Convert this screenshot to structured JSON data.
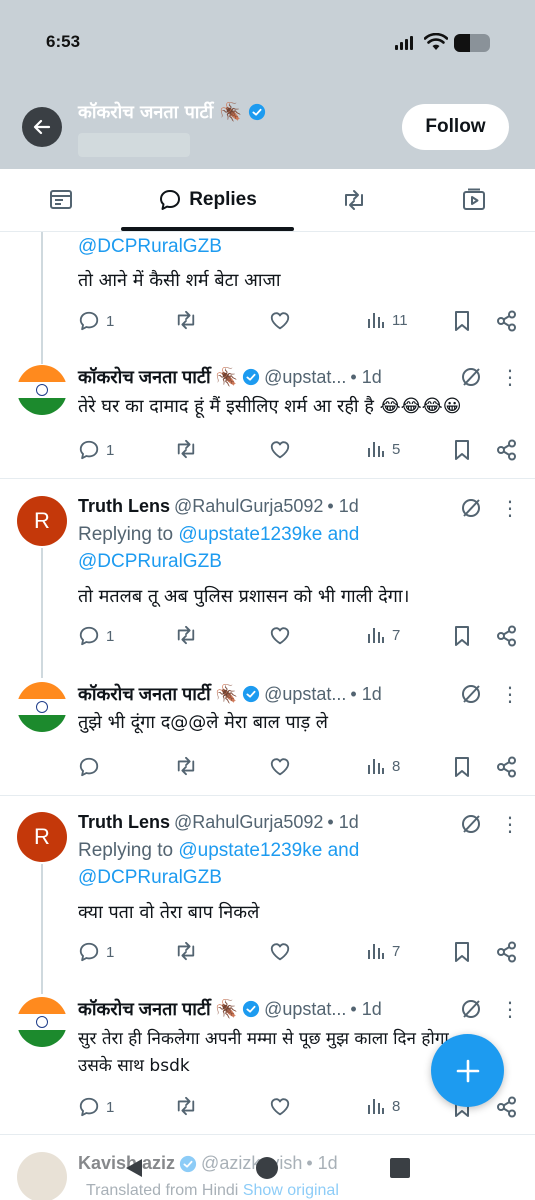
{
  "status_bar": {
    "time": "6:53",
    "battery_level": 0.45
  },
  "header": {
    "title": "कॉकरोच जनता पार्टी 🪳",
    "follow_label": "Follow"
  },
  "tabs": [
    {
      "name": "posts",
      "icon": "article-icon"
    },
    {
      "name": "replies",
      "label": "Replies",
      "icon": "speech-bubble-icon",
      "active": true
    },
    {
      "name": "reposts",
      "icon": "repost-icon"
    },
    {
      "name": "media",
      "icon": "media-icon"
    }
  ],
  "thread": {
    "top_partial": {
      "mention": "@DCPRuralGZB",
      "text": "तो आने में कैसी शर्म बेटा आजा",
      "replies": "1",
      "views": "11"
    },
    "posts": [
      {
        "name": "कॉकरोच जनता पार्टी 🪳",
        "handle": "@upstat...",
        "time": "• 1d",
        "text": "तेरे घर का दामाद हूं मैं इसीलिए शर्म आ रही है 😂😂😂😀",
        "replies": "1",
        "views": "5"
      },
      {
        "avatar_letter": "R",
        "name": "Truth Lens",
        "handle": "@RahulGurja5092",
        "time": "• 1d",
        "replying_prefix": "Replying to",
        "replying_to_1": "@upstate1239ke and",
        "replying_to_2": "@DCPRuralGZB",
        "text": "तो मतलब तू अब पुलिस प्रशासन को भी गाली देगा।",
        "replies": "1",
        "views": "7"
      },
      {
        "name": "कॉकरोच जनता पार्टी 🪳",
        "handle": "@upstat...",
        "time": "• 1d",
        "text": "तुझे भी दूंगा द@@ले मेरा बाल पाड़ ले",
        "replies": "",
        "views": "8"
      },
      {
        "avatar_letter": "R",
        "name": "Truth Lens",
        "handle": "@RahulGurja5092",
        "time": "• 1d",
        "replying_prefix": "Replying to",
        "replying_to_1": "@upstate1239ke and",
        "replying_to_2": "@DCPRuralGZB",
        "text": "क्या पता वो तेरा बाप निकले",
        "replies": "1",
        "views": "7"
      },
      {
        "name": "कॉकरोच जनता पार्टी 🪳",
        "handle": "@upstat...",
        "time": "• 1d",
        "text_line1": "सुर तेरा ही निकलेगा अपनी मम्मा से पूछ मुझ काला दिन होगा",
        "text_line2": "उसके साथ bsdk",
        "replies": "1",
        "views": "8"
      },
      {
        "name": "Kavish aziz",
        "handle": "@azizkavish",
        "time": "• 1d",
        "translated": "Translated from Hindi",
        "show_original": "Show original"
      }
    ]
  },
  "colors": {
    "header_bg": "#c8d0d6",
    "accent": "#1d9bf0",
    "secondary_text": "#536471",
    "saffron": "#ff8a1e",
    "green": "#1c8a2d",
    "avatar_r": "#c4380a"
  }
}
